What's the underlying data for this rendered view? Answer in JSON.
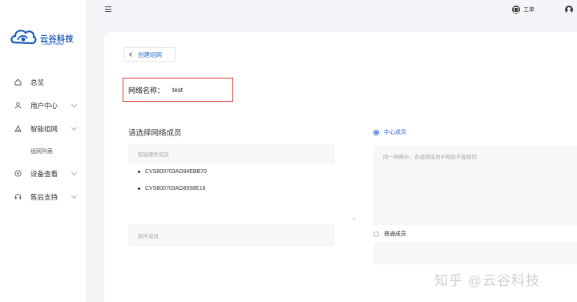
{
  "brand": {
    "name": "云谷科技",
    "tagline": "Cloud Valley"
  },
  "sidebar": {
    "items": [
      {
        "label": "总览",
        "icon": "home-icon"
      },
      {
        "label": "用户中心",
        "icon": "user-icon",
        "expandable": true
      },
      {
        "label": "智能组网",
        "icon": "network-icon",
        "expandable": true
      },
      {
        "label": "设备查看",
        "icon": "device-icon",
        "expandable": true
      },
      {
        "label": "售后支持",
        "icon": "headset-icon",
        "expandable": true
      }
    ],
    "sub_items": [
      {
        "label": "组网列表"
      }
    ]
  },
  "topbar": {
    "ticket_label": "工单"
  },
  "page": {
    "back_label": "创建组网",
    "network_name_label": "网络名称：",
    "network_name_value": "test",
    "members_title": "请选择网络成员",
    "hardware_header": "智能硬件成员",
    "hardware_members": [
      "CVS800703AD84EBB70",
      "CVS800703AD8558E18"
    ],
    "software_header": "软件成员",
    "center_member_label": "中心成员",
    "center_member_hint": "同一网络中，各组网成员中网段不能相同",
    "normal_member_label": "普通成员"
  },
  "watermark": "知乎 @云谷科技",
  "colors": {
    "accent": "#2a6cd0",
    "highlight_border": "#d9413b",
    "brand": "#1d5bb8"
  }
}
